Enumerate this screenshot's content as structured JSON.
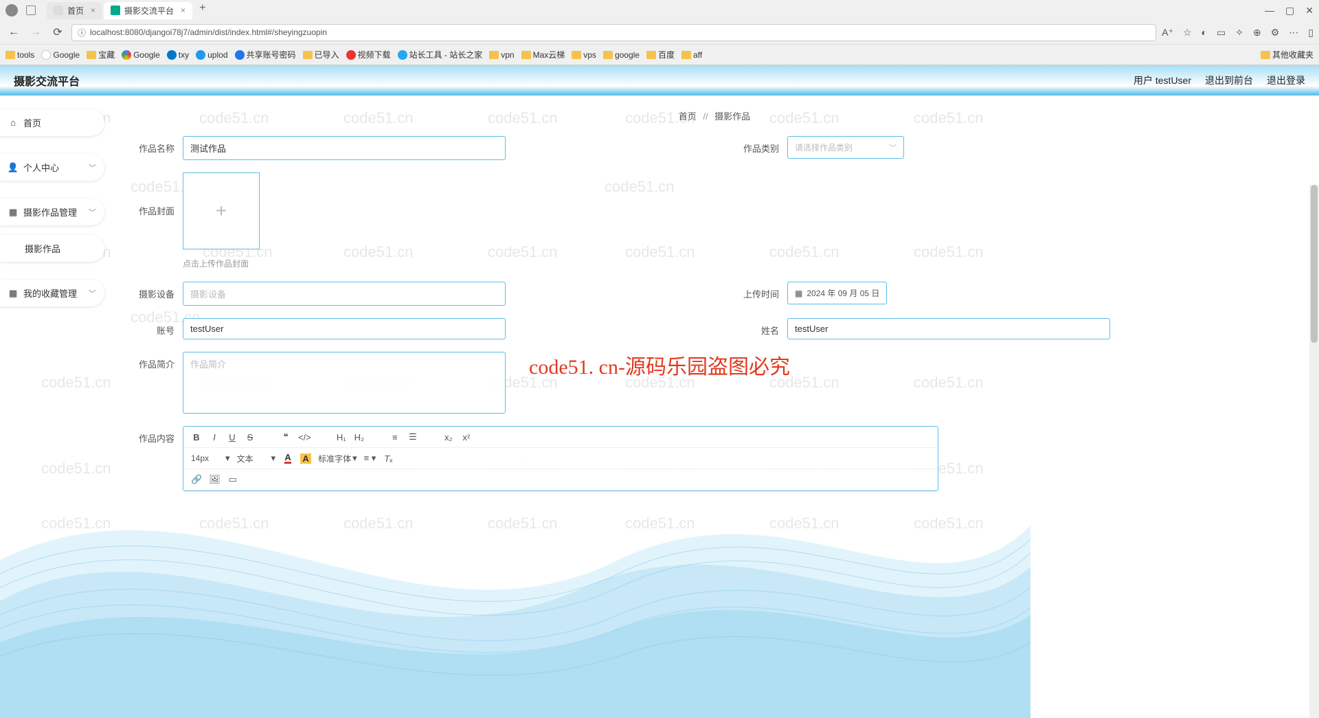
{
  "browser": {
    "tabs": [
      {
        "title": "首页",
        "active": false
      },
      {
        "title": "摄影交流平台",
        "active": true
      }
    ],
    "url": "localhost:8080/djangoi78j7/admin/dist/index.html#/sheyingzuopin",
    "bookmarks": [
      "tools",
      "Google",
      "宝藏",
      "Google",
      "txy",
      "uplod",
      "共享账号密码",
      "已导入",
      "视频下载",
      "站长工具 - 站长之家",
      "vpn",
      "Max云梯",
      "vps",
      "google",
      "百度",
      "aff"
    ],
    "other_bookmarks": "其他收藏夹"
  },
  "header": {
    "title": "摄影交流平台",
    "user_label": "用户 testUser",
    "front_link": "退出到前台",
    "logout": "退出登录"
  },
  "sidebar": {
    "home": "首页",
    "personal": "个人中心",
    "works_mgmt": "摄影作品管理",
    "works_sub": "摄影作品",
    "collection_mgmt": "我的收藏管理"
  },
  "breadcrumb": {
    "home": "首页",
    "sep": "//",
    "current": "摄影作品"
  },
  "form": {
    "name_label": "作品名称",
    "name_value": "测试作品",
    "category_label": "作品类别",
    "category_placeholder": "请选择作品类别",
    "cover_label": "作品封面",
    "cover_hint": "点击上传作品封面",
    "device_label": "摄影设备",
    "device_placeholder": "摄影设备",
    "upload_time_label": "上传时间",
    "upload_time_value": "2024 年 09 月 05 日",
    "account_label": "账号",
    "account_value": "testUser",
    "realname_label": "姓名",
    "realname_value": "testUser",
    "intro_label": "作品简介",
    "intro_placeholder": "作品简介",
    "content_label": "作品内容"
  },
  "editor": {
    "font_size": "14px",
    "para": "文本",
    "default_font": "标准字体"
  },
  "watermark": {
    "small": "code51.cn",
    "big": "code51. cn-源码乐园盗图必究"
  }
}
